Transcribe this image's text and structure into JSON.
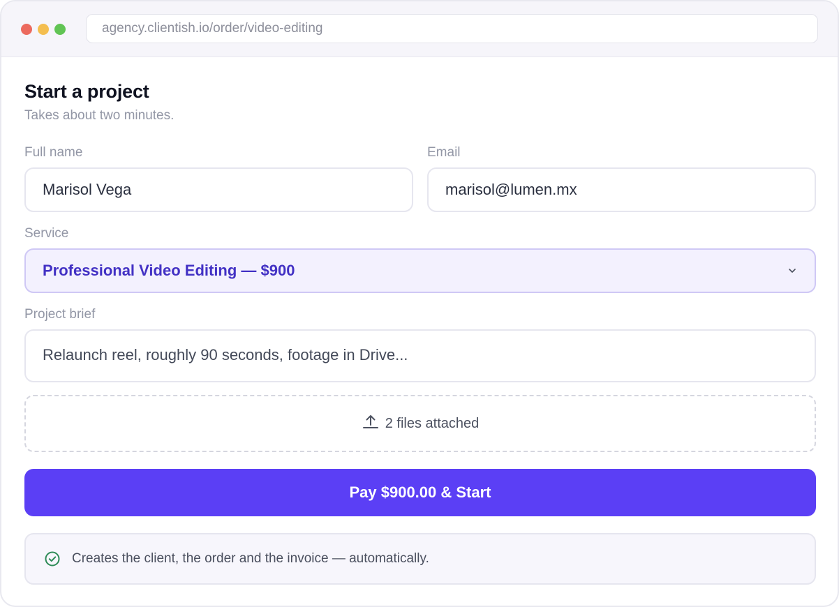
{
  "browser": {
    "url": "agency.clientish.io/order/video-editing"
  },
  "form": {
    "title": "Start a project",
    "subtitle": "Takes about two minutes.",
    "full_name": {
      "label": "Full name",
      "value": "Marisol Vega"
    },
    "email": {
      "label": "Email",
      "value": "marisol@lumen.mx"
    },
    "service": {
      "label": "Service",
      "value": "Professional Video Editing — $900"
    },
    "brief": {
      "label": "Project brief",
      "value": "Relaunch reel, roughly 90 seconds, footage in Drive..."
    },
    "attachments": {
      "text": "2 files attached",
      "icon": "upload-icon"
    },
    "submit_label": "Pay $900.00 & Start",
    "note": {
      "text": "Creates the client, the order and the invoice — automatically.",
      "icon": "check-circle-icon"
    }
  },
  "colors": {
    "accent": "#5b3ff5",
    "select_text": "#4231c4",
    "success": "#2e8b57"
  }
}
